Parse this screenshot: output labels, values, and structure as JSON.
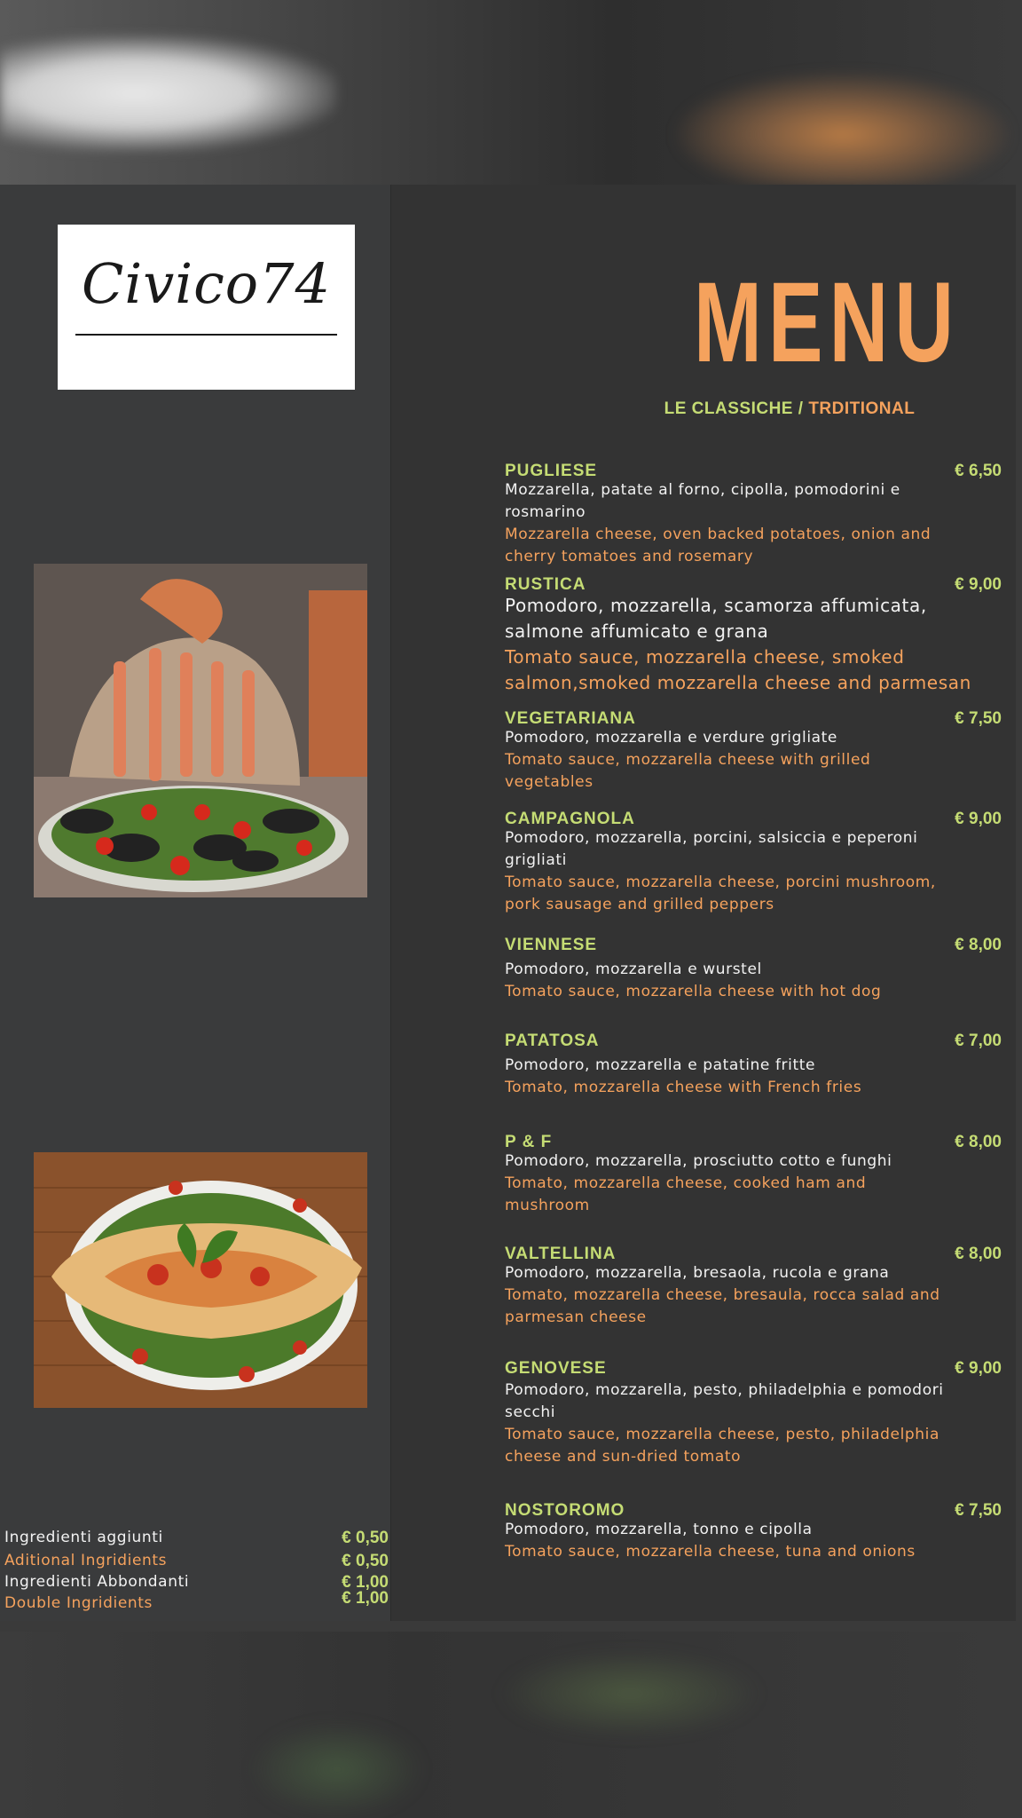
{
  "brand": {
    "logo_text": "Civico74"
  },
  "menu": {
    "title": "MENU",
    "section_italian": "LE CLASSICHE /",
    "section_english": "TRDITIONAL"
  },
  "items": [
    {
      "name": "PUGLIESE",
      "price": "€ 6,50",
      "italian": "Mozzarella, patate al forno, cipolla, pomodorini e rosmarino",
      "english": "Mozzarella cheese, oven backed potatoes, onion and cherry tomatoes and rosemary"
    },
    {
      "name": "RUSTICA",
      "price": "€ 9,00",
      "italian": "Pomodoro, mozzarella, scamorza affumicata, salmone affumicato e grana",
      "english": "Tomato sauce, mozzarella cheese, smoked salmon,smoked mozzarella cheese and parmesan"
    },
    {
      "name": "VEGETARIANA",
      "price": "€ 7,50",
      "italian": "Pomodoro, mozzarella e verdure grigliate",
      "english": "Tomato sauce, mozzarella cheese with grilled vegetables"
    },
    {
      "name": "CAMPAGNOLA",
      "price": "€ 9,00",
      "italian": "Pomodoro, mozzarella, porcini, salsiccia e peperoni grigliati",
      "english": "Tomato sauce, mozzarella cheese, porcini mushroom, pork sausage and grilled peppers"
    },
    {
      "name": "VIENNESE",
      "price": "€ 8,00",
      "italian": "Pomodoro, mozzarella e wurstel",
      "english": "Tomato sauce, mozzarella cheese with hot dog"
    },
    {
      "name": "PATATOSA",
      "price": "€ 7,00",
      "italian": "Pomodoro, mozzarella e patatine fritte",
      "english": "Tomato, mozzarella cheese with French fries"
    },
    {
      "name": "P & F",
      "price": "€ 8,00",
      "italian": "Pomodoro, mozzarella, prosciutto cotto e funghi",
      "english": "Tomato, mozzarella cheese, cooked ham and mushroom"
    },
    {
      "name": "VALTELLINA",
      "price": "€ 8,00",
      "italian": "Pomodoro, mozzarella, bresaola, rucola e grana",
      "english": "Tomato, mozzarella cheese, bresaula, rocca salad and parmesan cheese"
    },
    {
      "name": "GENOVESE",
      "price": "€ 9,00",
      "italian": "Pomodoro, mozzarella, pesto, philadelphia e pomodori secchi",
      "english": "Tomato sauce, mozzarella cheese, pesto, philadelphia cheese and sun-dried tomato"
    },
    {
      "name": "NOSTOROMO",
      "price": "€ 7,50",
      "italian": "Pomodoro, mozzarella, tonno e cipolla",
      "english": "Tomato sauce, mozzarella cheese, tuna and onions"
    }
  ],
  "extras": [
    {
      "label": "Ingredienti aggiunti",
      "price": "€ 0,50",
      "tone": "white"
    },
    {
      "label": "Aditional Ingridients",
      "price": "€ 0,50",
      "tone": "orange"
    },
    {
      "label": "Ingredienti Abbondanti",
      "price": "€ 1,00",
      "tone": "white"
    },
    {
      "label": "Double Ingridients",
      "price": "€ 1,00",
      "tone": "orange"
    }
  ],
  "colors": {
    "accent_orange": "#f5a25d",
    "accent_green": "#c5dc74",
    "panel": "#333333"
  }
}
